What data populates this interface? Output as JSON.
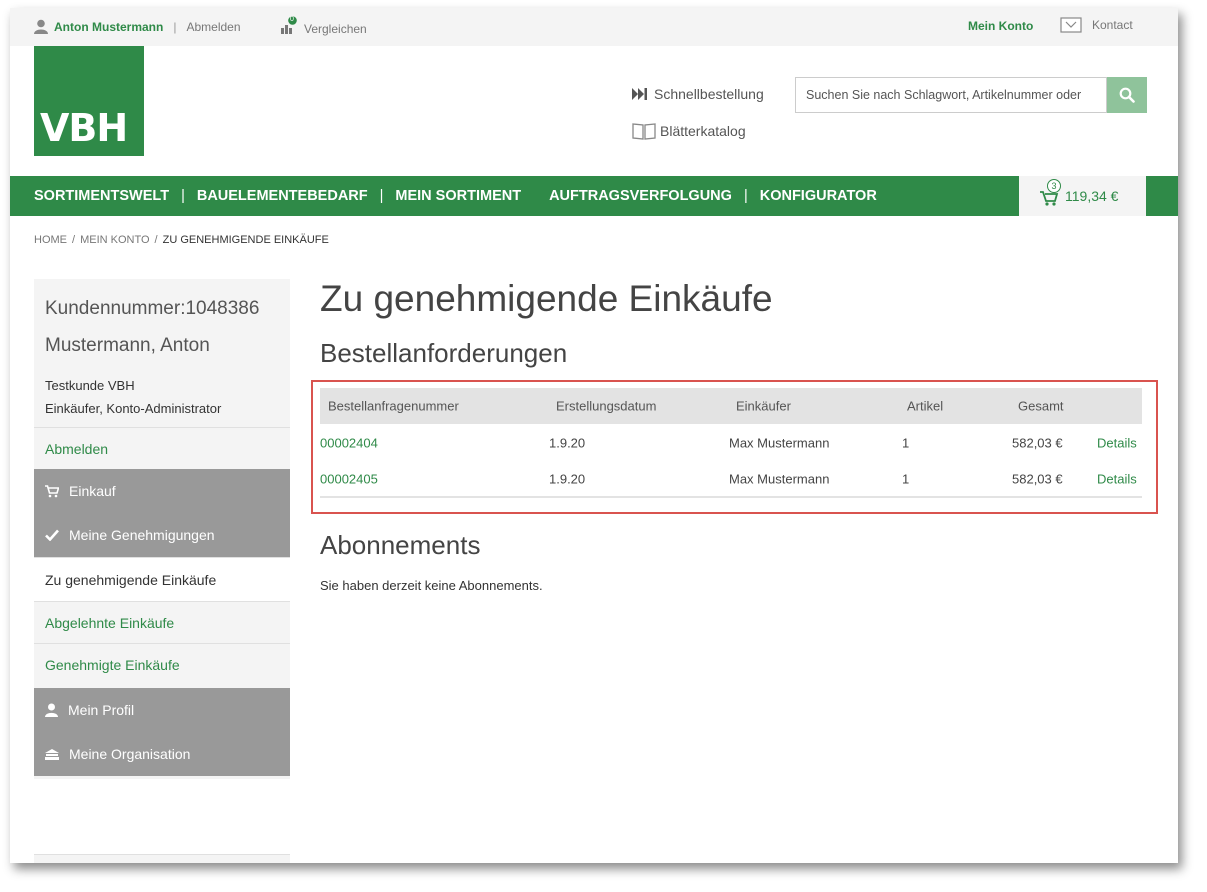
{
  "topbar": {
    "user_name": "Anton Mustermann",
    "separator": "|",
    "logout": "Abmelden",
    "compare_badge": "0",
    "compare": "Vergleichen",
    "account": "Mein Konto",
    "contact": "Kontact"
  },
  "header": {
    "logo_text": "VBH",
    "quick_order": "Schnellbestellung",
    "catalog": "Blätterkatalog",
    "search_placeholder": "Suchen Sie nach Schlagwort, Artikelnummer oder"
  },
  "nav": {
    "items": [
      "SORTIMENTSWELT",
      "BAUELEMENTEBEDARF",
      "MEIN SORTIMENT",
      "AUFTRAGSVERFOLGUNG",
      "KONFIGURATOR"
    ],
    "separator": "|",
    "cart_count": "3",
    "cart_total": "119,34 €"
  },
  "breadcrumb": {
    "items": [
      "HOME",
      "MEIN KONTO",
      "ZU GENEHMIGENDE EINKÄUFE"
    ],
    "separator": "/"
  },
  "sidebar": {
    "customer_number": "Kundennummer:1048386",
    "name": "Mustermann, Anton",
    "company": "Testkunde VBH",
    "roles": "Einkäufer, Konto-Administrator",
    "logout": "Abmelden",
    "purchase": "Einkauf",
    "approvals": "Meine Genehmigungen",
    "to_approve": "Zu genehmigende Einkäufe",
    "rejected": "Abgelehnte Einkäufe",
    "approved": "Genehmigte Einkäufe",
    "profile": "Mein Profil",
    "organisation": "Meine Organisation"
  },
  "main": {
    "title": "Zu genehmigende Einkäufe",
    "subtitle": "Bestellanforderungen",
    "columns": [
      "Bestellanfragenummer",
      "Erstellungsdatum",
      "Einkäufer",
      "Artikel",
      "Gesamt"
    ],
    "rows": [
      {
        "number": "00002404",
        "date": "1.9.20",
        "buyer": "Max Mustermann",
        "items": "1",
        "total": "582,03 €",
        "details": "Details"
      },
      {
        "number": "00002405",
        "date": "1.9.20",
        "buyer": "Max Mustermann",
        "items": "1",
        "total": "582,03 €",
        "details": "Details"
      }
    ],
    "subscriptions_title": "Abonnements",
    "subscriptions_text": "Sie haben derzeit keine Abonnements."
  },
  "colors": {
    "brand_green": "#2f8a48",
    "highlight_red": "#d9534f",
    "sidebar_grey": "#999999"
  }
}
